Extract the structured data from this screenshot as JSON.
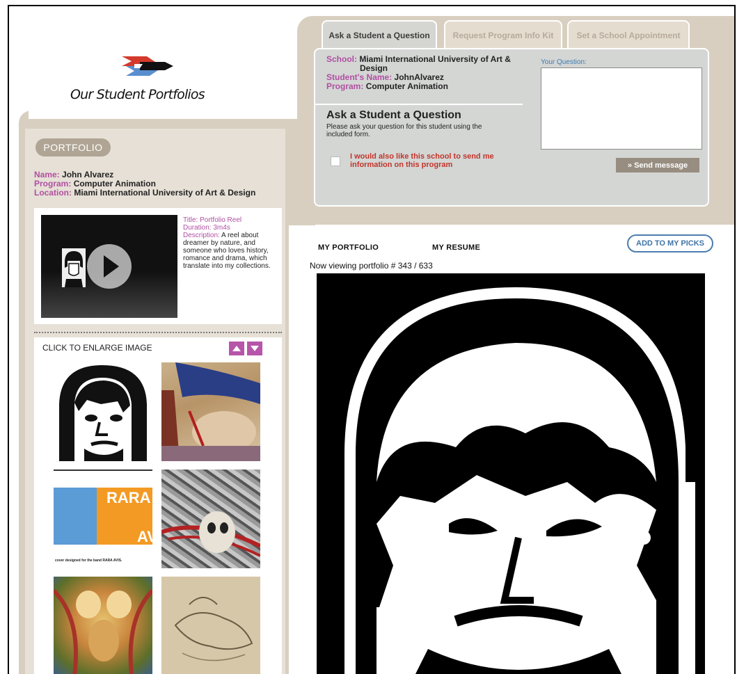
{
  "logo": {
    "text": "Our Student Portfolios"
  },
  "top_tabs": [
    {
      "label": "Ask a Student a Question",
      "active": true
    },
    {
      "label": "Request Program Info Kit",
      "active": false
    },
    {
      "label": "Set a School Appointment",
      "active": false
    }
  ],
  "question_panel": {
    "school_label": "School:",
    "school_value_line1": "Miami International University of Art &",
    "school_value_line2": "Design",
    "student_label": "Student's Name:",
    "student_value": "JohnAlvarez",
    "program_label": "Program:",
    "program_value": "Computer Animation",
    "title": "Ask a Student a Question",
    "description": "Please ask your question for this student using the included form.",
    "checkbox_label": "I would also like this school to send me information on this program",
    "your_question_label": "Your Question:",
    "question_value": "",
    "send_label": "» Send message"
  },
  "portfolio_badge": "PORTFOLIO",
  "student": {
    "name_label": "Name:",
    "name": "John Alvarez",
    "program_label": "Program:",
    "program": "Computer Animation",
    "location_label": "Location:",
    "location": "Miami International University of Art & Design"
  },
  "video": {
    "title_label": "Title:",
    "title": "Portfolio Reel",
    "duration_label": "Duration:",
    "duration": "3m4s",
    "description_label": "Description:",
    "description": "A reel about dreamer by nature, and someone who loves history, romance and drama, which translate into my collections."
  },
  "gallery": {
    "click_label": "CLICK TO ENLARGE IMAGE",
    "thumb4_text": "RARA",
    "thumb4_caption": "cover designed for the band RARA AVIS."
  },
  "viewer_tabs": [
    {
      "label": "MY PORTFOLIO",
      "active": true
    },
    {
      "label": "MY RESUME",
      "active": false
    }
  ],
  "add_picks_label": "ADD TO MY PICKS",
  "viewing_text": "Now viewing portfolio # 343 / 633",
  "colors": {
    "accent_purple": "#b04fa2",
    "beige": "#d8cfc0",
    "panel_gray": "#d4d6d4",
    "link_blue": "#3f73a8"
  }
}
